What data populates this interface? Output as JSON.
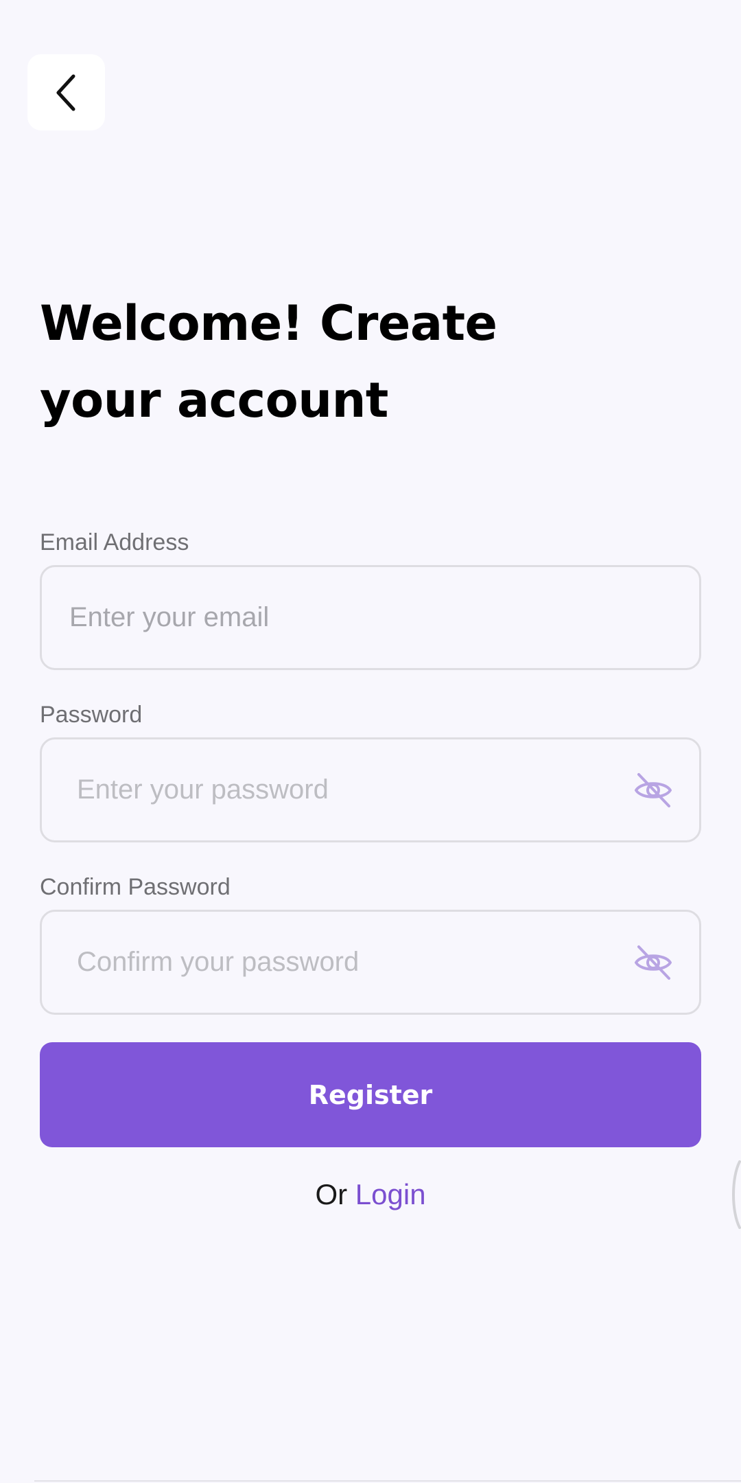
{
  "navigation": {
    "back_icon": "chevron-left-icon"
  },
  "header": {
    "title_line1": "Welcome! Create",
    "title_line2": "your account"
  },
  "form": {
    "email": {
      "label": "Email Address",
      "placeholder": "Enter your email",
      "value": ""
    },
    "password": {
      "label": "Password",
      "placeholder": "Enter your password",
      "value": "",
      "toggle_icon": "eye-off-icon"
    },
    "confirm_password": {
      "label": "Confirm Password",
      "placeholder": "Confirm your password",
      "value": "",
      "toggle_icon": "eye-off-icon"
    },
    "submit_label": "Register"
  },
  "footer": {
    "alt_prefix": "Or",
    "login_label": "Login"
  },
  "colors": {
    "background": "#F8F7FD",
    "accent": "#8056D9",
    "link": "#7B4FD0",
    "icon_muted": "#B8A4E3"
  }
}
